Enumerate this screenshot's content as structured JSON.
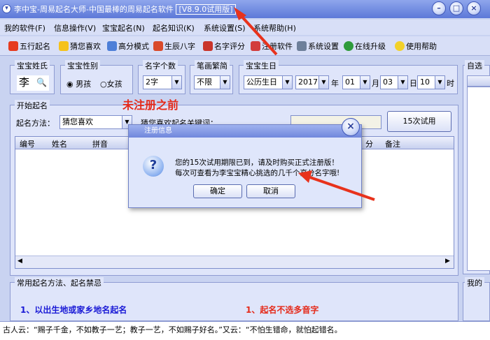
{
  "window": {
    "title": "李中宝-周易起名大师-中国最棒的周易起名软件",
    "version": "[V8.9.0试用版]",
    "sys_icon": "chevron-down-icon",
    "controls": [
      "minimize-icon",
      "maximize-icon",
      "close-icon"
    ]
  },
  "menu": [
    "我的软件(F)",
    "信息操作(V)",
    "宝宝起名(N)",
    "起名知识(K)",
    "系统设置(S)",
    "系统帮助(H)"
  ],
  "toolbar": [
    {
      "label": "五行起名",
      "icon": "five-elements-icon"
    },
    {
      "label": "猜您喜欢",
      "icon": "star-icon"
    },
    {
      "label": "高分模式",
      "icon": "chart-icon"
    },
    {
      "label": "生辰八字",
      "icon": "calendar-icon"
    },
    {
      "label": "名字评分",
      "icon": "score-icon"
    },
    {
      "label": "注册软件",
      "icon": "register-icon"
    },
    {
      "label": "系统设置",
      "icon": "settings-icon"
    },
    {
      "label": "在线升级",
      "icon": "globe-icon"
    },
    {
      "label": "使用帮助",
      "icon": "lightbulb-icon"
    }
  ],
  "form": {
    "surname": {
      "title": "宝宝姓氏",
      "value": "李"
    },
    "gender": {
      "title": "宝宝性别",
      "options": [
        "男孩",
        "女孩"
      ],
      "selected": "男孩"
    },
    "name_length": {
      "title": "名字个数",
      "value": "2字"
    },
    "strokes": {
      "title": "笔画繁简",
      "value": "不限"
    },
    "birth": {
      "title": "宝宝生日",
      "calendar": "公历生日",
      "year": "2017",
      "year_unit": "年",
      "month": "01",
      "month_unit": "月",
      "day": "03",
      "day_unit": "日",
      "hour": "10",
      "hour_unit": "时"
    },
    "right_group_title": "自选"
  },
  "naming": {
    "group_title": "开始起名",
    "method_label": "起名方法：",
    "method_value": "猜您喜欢",
    "keyword_label": "猜您喜欢起名关键词：",
    "trial_button": "15次试用",
    "unregistered_note": "未注册之前",
    "columns": [
      "编号",
      "姓名",
      "拼音",
      "分",
      "备注"
    ]
  },
  "dialog": {
    "title": "注册信息",
    "message_line1": "您的15次试用期限已到，请及时购买正式注册版！",
    "message_line2": "每次可查看为李宝宝精心挑选的几千个高分名字哦!",
    "icon": "question-icon",
    "ok": "确定",
    "cancel": "取消"
  },
  "tips": {
    "group_title": "常用起名方法、起名禁忌",
    "right_group_title": "我的",
    "tip_left": "1、以出生地或家乡地名起名",
    "tip_right": "1、起名不选多音字"
  },
  "status": {
    "quote": "古人云：“赐子千金，不如教子一艺；教子一艺，不如赐子好名。”又云：“不怕生错命，就怕起错名。"
  },
  "colors": {
    "accent_blue": "#1a1ad6",
    "accent_red": "#e52a1a",
    "title_bar": "#5c78d8"
  }
}
